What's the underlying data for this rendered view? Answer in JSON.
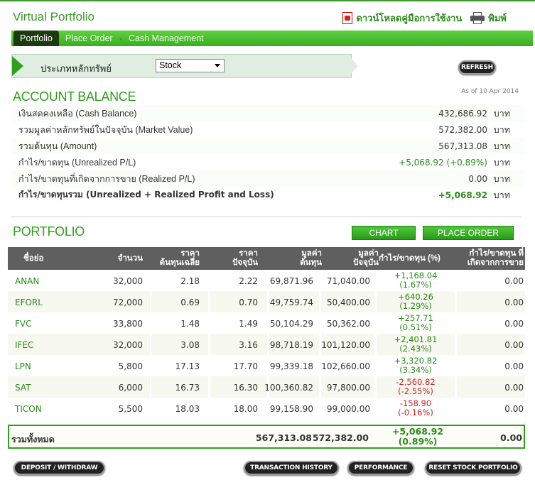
{
  "app": {
    "title": "Virtual Portfolio",
    "download_manual": "ดาวน์โหลดคู่มือการใช้งาน",
    "print": "พิมพ์"
  },
  "nav": {
    "tabs": [
      {
        "label": "Portfolio",
        "active": true
      },
      {
        "label": "Place Order",
        "active": false
      },
      {
        "label": "Cash Management",
        "active": false
      }
    ]
  },
  "filter": {
    "label": "ประเภทหลักทรัพย์",
    "selected": "Stock"
  },
  "refresh_button": "REFRESH",
  "account": {
    "title": "ACCOUNT BALANCE",
    "as_of": "As of 10 Apr 2014",
    "unit": "บาท",
    "rows": [
      {
        "label": "เงินสดคงเหลือ (Cash Balance)",
        "value": "432,686.92"
      },
      {
        "label": "รวมมูลค่าหลักทรัพย์ในปัจจุบัน (Market Value)",
        "value": "572,382.00"
      },
      {
        "label": "รวมต้นทุน (Amount)",
        "value": "567,313.08"
      },
      {
        "label": "กำไร/ขาดทุน (Unrealized P/L)",
        "value": "+5,068.92 (+0.89%)"
      },
      {
        "label": "กำไร/ขาดทุนที่เกิดจากการขาย (Realized P/L)",
        "value": "0.00"
      },
      {
        "label": "กำไร/ขาดทุนรวม (Unrealized + Realized Profit and Loss)",
        "value": "+5,068.92"
      }
    ]
  },
  "portfolio": {
    "title": "PORTFOLIO",
    "chart_button": "CHART",
    "place_order_button": "PLACE ORDER",
    "columns": {
      "symbol": "ชื่อย่อ",
      "volume": "จำนวน",
      "avg_cost_1": "ราคา",
      "avg_cost_2": "ต้นทุนเฉลี่ย",
      "price_1": "ราคา",
      "price_2": "ปัจจุบัน",
      "cost_value_1": "มูลค่า",
      "cost_value_2": "ต้นทุน",
      "market_value_1": "มูลค่า",
      "market_value_2": "ปัจจุบัน",
      "unrealized": "กำไร/ขาดทุน (%)",
      "realized_1": "กำไร/ขาดทุน ที่",
      "realized_2": "เกิดจากการขาย"
    },
    "rows": [
      {
        "symbol": "ANAN",
        "volume": "32,000",
        "avg_cost": "2.18",
        "price": "2.22",
        "cost_value": "69,871.96",
        "market_value": "71,040.00",
        "pl": "+1,168.04",
        "pl_pct": "(1.67%)",
        "realized": "0.00",
        "sign": "pos"
      },
      {
        "symbol": "EFORL",
        "volume": "72,000",
        "avg_cost": "0.69",
        "price": "0.70",
        "cost_value": "49,759.74",
        "market_value": "50,400.00",
        "pl": "+640.26",
        "pl_pct": "(1.29%)",
        "realized": "0.00",
        "sign": "pos"
      },
      {
        "symbol": "FVC",
        "volume": "33,800",
        "avg_cost": "1.48",
        "price": "1.49",
        "cost_value": "50,104.29",
        "market_value": "50,362.00",
        "pl": "+257.71",
        "pl_pct": "(0.51%)",
        "realized": "0.00",
        "sign": "pos"
      },
      {
        "symbol": "IFEC",
        "volume": "32,000",
        "avg_cost": "3.08",
        "price": "3.16",
        "cost_value": "98,718.19",
        "market_value": "101,120.00",
        "pl": "+2,401.81",
        "pl_pct": "(2.43%)",
        "realized": "0.00",
        "sign": "pos"
      },
      {
        "symbol": "LPN",
        "volume": "5,800",
        "avg_cost": "17.13",
        "price": "17.70",
        "cost_value": "99,339.18",
        "market_value": "102,660.00",
        "pl": "+3,320.82",
        "pl_pct": "(3.34%)",
        "realized": "0.00",
        "sign": "pos"
      },
      {
        "symbol": "SAT",
        "volume": "6,000",
        "avg_cost": "16.73",
        "price": "16.30",
        "cost_value": "100,360.82",
        "market_value": "97,800.00",
        "pl": "-2,560.82",
        "pl_pct": "(-2.55%)",
        "realized": "0.00",
        "sign": "neg"
      },
      {
        "symbol": "TICON",
        "volume": "5,500",
        "avg_cost": "18.03",
        "price": "18.00",
        "cost_value": "99,158.90",
        "market_value": "99,000.00",
        "pl": "-158.90",
        "pl_pct": "(-0.16%)",
        "realized": "0.00",
        "sign": "neg"
      }
    ],
    "total": {
      "label": "รวมทั้งหมด",
      "cost_value": "567,313.08",
      "market_value": "572,382.00",
      "pl": "+5,068.92",
      "pl_pct": "(0.89%)",
      "realized": "0.00"
    }
  },
  "footer_buttons": {
    "deposit": "DEPOSIT / WITHDRAW",
    "history": "TRANSACTION HISTORY",
    "performance": "PERFORMANCE",
    "reset": "RESET STOCK PORTFOLIO"
  },
  "colors": {
    "brand_green": "#2fa01c",
    "positive": "#2a8a1a",
    "negative": "#d42020",
    "header_gray": "#5f5f5f"
  }
}
